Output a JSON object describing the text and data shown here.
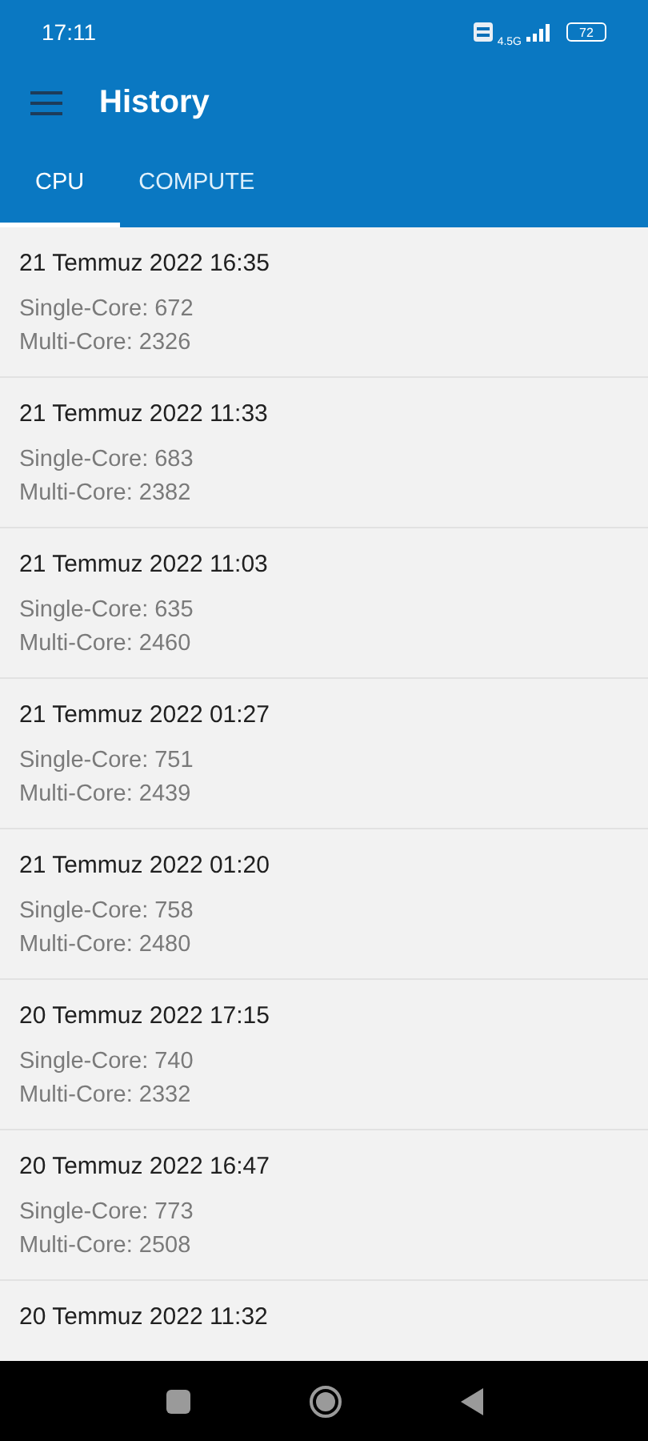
{
  "status_bar": {
    "time": "17:11",
    "network": "4.5G",
    "battery": "72"
  },
  "app_bar": {
    "title": "History"
  },
  "tabs": [
    {
      "label": "CPU",
      "selected": true
    },
    {
      "label": "COMPUTE",
      "selected": false
    }
  ],
  "results": [
    {
      "date": "21 Temmuz 2022 16:35",
      "single": "Single-Core: 672",
      "multi": "Multi-Core: 2326"
    },
    {
      "date": "21 Temmuz 2022 11:33",
      "single": "Single-Core: 683",
      "multi": "Multi-Core: 2382"
    },
    {
      "date": "21 Temmuz 2022 11:03",
      "single": "Single-Core: 635",
      "multi": "Multi-Core: 2460"
    },
    {
      "date": "21 Temmuz 2022 01:27",
      "single": "Single-Core: 751",
      "multi": "Multi-Core: 2439"
    },
    {
      "date": "21 Temmuz 2022 01:20",
      "single": "Single-Core: 758",
      "multi": "Multi-Core: 2480"
    },
    {
      "date": "20 Temmuz 2022 17:15",
      "single": "Single-Core: 740",
      "multi": "Multi-Core: 2332"
    },
    {
      "date": "20 Temmuz 2022 16:47",
      "single": "Single-Core: 773",
      "multi": "Multi-Core: 2508"
    },
    {
      "date": "20 Temmuz 2022 11:32"
    }
  ]
}
